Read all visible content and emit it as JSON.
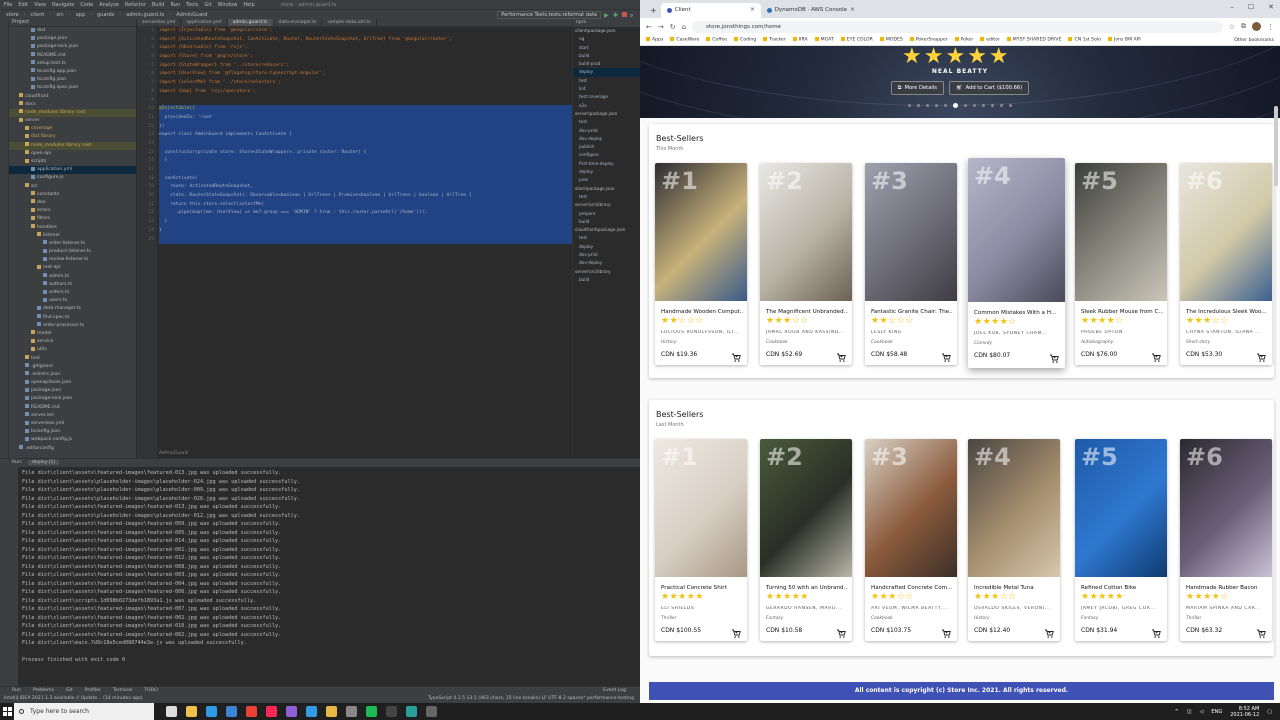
{
  "ide": {
    "menu": [
      "File",
      "Edit",
      "View",
      "Navigate",
      "Code",
      "Analyze",
      "Refactor",
      "Build",
      "Run",
      "Tools",
      "Git",
      "Window",
      "Help"
    ],
    "title": "store - admin.guard.ts",
    "breadcrumbs": [
      "store",
      "client",
      "src",
      "app",
      "guards",
      "admin.guard.ts",
      "AdminGuard"
    ],
    "run_config": "Performance Tests,tests:reformat data",
    "project_label": "Project",
    "tree": [
      {
        "label": "dist",
        "indent": 3
      },
      {
        "label": "package.json",
        "indent": 3
      },
      {
        "label": "package-lock.json",
        "indent": 3
      },
      {
        "label": "README.md",
        "indent": 3
      },
      {
        "label": "setup.test.ts",
        "indent": 3
      },
      {
        "label": "tsconfig.app.json",
        "indent": 3
      },
      {
        "label": "tsconfig.json",
        "indent": 3
      },
      {
        "label": "tsconfig.spec.json",
        "indent": 3
      },
      {
        "label": "cloudfront",
        "indent": 1
      },
      {
        "label": "docs",
        "indent": 1
      },
      {
        "label": "node_modules library root",
        "indent": 1
      },
      {
        "label": "server",
        "indent": 1
      },
      {
        "label": "coverage",
        "indent": 2
      },
      {
        "label": "dist library",
        "indent": 2
      },
      {
        "label": "node_modules library root",
        "indent": 2
      },
      {
        "label": "open-api",
        "indent": 2
      },
      {
        "label": "scripts",
        "indent": 2
      },
      {
        "label": "application.yml",
        "indent": 3
      },
      {
        "label": "configure.js",
        "indent": 3
      },
      {
        "label": "src",
        "indent": 2
      },
      {
        "label": "constants",
        "indent": 3
      },
      {
        "label": "dao",
        "indent": 3
      },
      {
        "label": "errors",
        "indent": 3
      },
      {
        "label": "filters",
        "indent": 3
      },
      {
        "label": "handlers",
        "indent": 3
      },
      {
        "label": "listener",
        "indent": 4
      },
      {
        "label": "order-listener.ts",
        "indent": 5
      },
      {
        "label": "product-listener.ts",
        "indent": 5
      },
      {
        "label": "review-listener.ts",
        "indent": 5
      },
      {
        "label": "rest-api",
        "indent": 4
      },
      {
        "label": "admin.ts",
        "indent": 5
      },
      {
        "label": "authors.ts",
        "indent": 5
      },
      {
        "label": "orders.ts",
        "indent": 5
      },
      {
        "label": "users.ts",
        "indent": 5
      },
      {
        "label": "data-manager.ts",
        "indent": 4
      },
      {
        "label": "find.spec.ts",
        "indent": 4
      },
      {
        "label": "order-processor.ts",
        "indent": 4
      },
      {
        "label": "model",
        "indent": 3
      },
      {
        "label": "service",
        "indent": 3
      },
      {
        "label": "utils",
        "indent": 3
      },
      {
        "label": "test",
        "indent": 2
      },
      {
        "label": ".gitignore",
        "indent": 2
      },
      {
        "label": ".eslintrc.json",
        "indent": 2
      },
      {
        "label": "openapitools.json",
        "indent": 2
      },
      {
        "label": "package.json",
        "indent": 2
      },
      {
        "label": "package-lock.json",
        "indent": 2
      },
      {
        "label": "README.md",
        "indent": 2
      },
      {
        "label": "server.iml",
        "indent": 2
      },
      {
        "label": "serverless.yml",
        "indent": 2
      },
      {
        "label": "tsconfig.json",
        "indent": 2
      },
      {
        "label": "webpack.config.js",
        "indent": 2
      },
      {
        "label": ".editorconfig",
        "indent": 1
      }
    ],
    "tabs": [
      "serverless.yml",
      "application.yml",
      "admin.guard.ts",
      "data-manager.ts",
      "sample-data.util.ts"
    ],
    "active_tab": 2,
    "code": [
      "import {Injectable} from '@angular/core';",
      "import {ActivatedRouteSnapshot, CanActivate, Router, RouterStateSnapshot, UrlTree} from '@angular/router';",
      "import {Observable} from 'rxjs';",
      "import {Store} from '@ngrx/store';",
      "import {StateWrapper} from '../store/reducers';",
      "import {UserView} from '@flagship/store-typescript-angular';",
      "import {selectMe} from '../store/selectors';",
      "import {map} from 'rxjs/operators';",
      "",
      "@Injectable({",
      "  providedIn: 'root'",
      "})",
      "export class AdminGuard implements CanActivate {",
      "",
      "  constructor(private store: Store<StateWrapper>, private router: Router) {",
      "  }",
      "",
      "  canActivate(",
      "    route: ActivatedRouteSnapshot,",
      "    state: RouterStateSnapshot): Observable<boolean | UrlTree> | Promise<boolean | UrlTree> | boolean | UrlTree {",
      "    return this.store.select(selectMe)",
      "      .pipe(map((me: UserView) => me?.group === 'ADMIN' ? true : this.router.parseUrl('/home')));",
      "  }",
      "}",
      ""
    ],
    "editor_footer": "AdminGuard",
    "npm_panel_label": "npm",
    "npm_scripts": [
      "client\\package.json",
      "ng",
      "start",
      "build",
      "build-prod",
      "deploy",
      "test",
      "lint",
      "test:coverage",
      "e2e",
      "server\\package.json",
      "test",
      "dev-print",
      "dev-deploy",
      "publish",
      "configure",
      "first-time-deploy",
      "deploy",
      "prex",
      "store\\package.json",
      "test",
      "server\\src\\library",
      "prepare",
      "build",
      "cloudfront\\package.json",
      "test",
      "deploy",
      "dev-print",
      "dev-deploy",
      "server\\src\\library",
      "build"
    ],
    "run_tab_label": "Run:",
    "run_config_name": "deploy [1]",
    "console_lines": [
      "File dist\\client\\assets\\featured-images\\featured-013.jpg was uploaded successfully.",
      "File dist\\client\\assets\\placeholder-images\\placeholder-024.jpg was uploaded successfully.",
      "File dist\\client\\assets\\placeholder-images\\placeholder-009.jpg was uploaded successfully.",
      "File dist\\client\\assets\\placeholder-images\\placeholder-026.jpg was uploaded successfully.",
      "File dist\\client\\assets\\featured-images\\featured-013.jpg was uploaded successfully.",
      "File dist\\client\\assets\\placeholder-images\\placeholder-012.jpg was uploaded successfully.",
      "File dist\\client\\assets\\featured-images\\featured-009.jpg was uploaded successfully.",
      "File dist\\client\\assets\\featured-images\\featured-005.jpg was uploaded successfully.",
      "File dist\\client\\assets\\featured-images\\featured-014.jpg was uploaded successfully.",
      "File dist\\client\\assets\\featured-images\\featured-001.jpg was uploaded successfully.",
      "File dist\\client\\assets\\featured-images\\featured-012.jpg was uploaded successfully.",
      "File dist\\client\\assets\\featured-images\\featured-008.jpg was uploaded successfully.",
      "File dist\\client\\assets\\featured-images\\featured-003.jpg was uploaded successfully.",
      "File dist\\client\\assets\\featured-images\\featured-004.jpg was uploaded successfully.",
      "File dist\\client\\assets\\featured-images\\featured-006.jpg was uploaded successfully.",
      "File dist\\client\\scripts.1d098b0273defb1893a1.js was uploaded successfully.",
      "File dist\\client\\assets\\featured-images\\featured-007.jpg was uploaded successfully.",
      "File dist\\client\\assets\\featured-images\\featured-002.jpg was uploaded successfully.",
      "File dist\\client\\assets\\featured-images\\featured-010.jpg was uploaded successfully.",
      "File dist\\client\\assets\\featured-images\\featured-002.jpg was uploaded successfully.",
      "File dist\\client\\main.7d9c18e5ced080744e3e.js was uploaded successfully.",
      "",
      "Process finished with exit code 0"
    ],
    "bottom_tabs": [
      "Run",
      "Problems",
      "Git",
      "Profiler",
      "Terminal",
      "TODO"
    ],
    "event_log": "Event Log",
    "status_left": "IntelliJ IDEA 2021.1.3 available // Update... (14 minutes ago)",
    "status_right": "TypeScript 4.1.5   13:1 (463 chars, 15 line breaks)   LF   UTF-8   2 spaces*   performance-testing"
  },
  "browser": {
    "tabs": [
      {
        "label": "Client",
        "active": true
      },
      {
        "label": "DynamoDB · AWS Console",
        "active": false
      }
    ],
    "url": "store.jonsthings.com/home",
    "bookmarks": [
      "Apps",
      "CaseWare",
      "Coffee",
      "Coding",
      "Tracker",
      "IIRA",
      "MGAT",
      "EYE COLOR",
      "MODES",
      "PokerSnapper",
      "Poker",
      "editor",
      "MYST SHARED DRIVE",
      "CN 1st Solo",
      "Jons BM API"
    ],
    "other_bookmarks": "Other bookmarks",
    "hero": {
      "author": "NEAL BEATTY",
      "rating": 5,
      "more_details": "More Details",
      "add_to_cart": "Add to Cart ($100.66)",
      "dots": 12,
      "active_dot": 5
    },
    "sections": [
      {
        "title": "Best-Sellers",
        "subtitle": "This Month",
        "books": [
          {
            "rank": "#1",
            "title": "Handmade Wooden Comput...",
            "rating": 2,
            "authors": "LUCIOUS RUNOLFSSON, ILI...",
            "genre": "History",
            "price": "CDN $19.36",
            "colors": [
              "#2d2d33",
              "#c8b27a",
              "#3a5a8a"
            ]
          },
          {
            "rank": "#2",
            "title": "The Magnificent Unbranded...",
            "rating": 3,
            "authors": "JAMAL ROOB AND KASSIND...",
            "genre": "Cookbook",
            "price": "CDN $52.69",
            "colors": [
              "#e8e8e4",
              "#b9b3a6",
              "#6b6154"
            ]
          },
          {
            "rank": "#3",
            "title": "Fantastic Granite Chair: The...",
            "rating": 2,
            "authors": "LESLY KING",
            "genre": "Cookbook",
            "price": "CDN $58.48",
            "colors": [
              "#9ea1ae",
              "#6c6b77",
              "#3f3c42"
            ]
          },
          {
            "rank": "#4",
            "title": "Common Mistakes With a H...",
            "rating": 4,
            "authors": "JOEL KUB, SYDNEY CHAM...",
            "genre": "Comedy",
            "price": "CDN $80.07",
            "colors": [
              "#b6b5c9",
              "#8c8aa3",
              "#4b4a58"
            ]
          },
          {
            "rank": "#5",
            "title": "Sleek Rubber Mouse from C...",
            "rating": 4,
            "authors": "PHOEBE UPTON",
            "genre": "Autobiography",
            "price": "CDN $76.00",
            "colors": [
              "#3c3f3a",
              "#8e8c82",
              "#c9c5b8"
            ]
          },
          {
            "rank": "#6",
            "title": "The Incredulous Sleek Woo...",
            "rating": 3,
            "authors": "CHYNA STANTON, ILIANA ...",
            "genre": "Short story",
            "price": "CDN $53.30",
            "colors": [
              "#e8e6df",
              "#d2c9a8",
              "#3b5f8f"
            ]
          }
        ]
      },
      {
        "title": "Best-Sellers",
        "subtitle": "Last Month",
        "books": [
          {
            "rank": "#1",
            "title": "Practical Concrete Shirt",
            "rating": 5,
            "authors": "ELI SHIELDS",
            "genre": "Thriller",
            "price": "CDN $100.55",
            "colors": [
              "#efe9e2",
              "#d8cfc4",
              "#a89886"
            ]
          },
          {
            "rank": "#2",
            "title": "Turning 50 with an Unbrand...",
            "rating": 5,
            "authors": "GERARDO HANSEN, MARG...",
            "genre": "Fantasy",
            "price": "CDN $10.58",
            "colors": [
              "#4a5b3c",
              "#2a2f25",
              "#b9b7a8"
            ]
          },
          {
            "rank": "#3",
            "title": "Handcrafted Concrete Com...",
            "rating": 3,
            "authors": "ARI VEUM, WILMA BEATTY,...",
            "genre": "Cookbook",
            "price": "CDN $103.75",
            "colors": [
              "#d9d2c6",
              "#8a5a3c",
              "#3c2f28"
            ]
          },
          {
            "rank": "#4",
            "title": "Incredible Metal Tuna",
            "rating": 3,
            "authors": "OSVALDO SKILES, VERONI...",
            "genre": "History",
            "price": "CDN $12.40",
            "colors": [
              "#4a4642",
              "#a58e6e",
              "#d8c7ab"
            ]
          },
          {
            "rank": "#5",
            "title": "Refined Cotton Bike",
            "rating": 5,
            "authors": "JAMEY JACOBI, GREG COR...",
            "genre": "Fantasy",
            "price": "CDN $31.94",
            "colors": [
              "#1e5aa8",
              "#2f78d0",
              "#0f3a70"
            ]
          },
          {
            "rank": "#6",
            "title": "Handmade Rubber Bacon",
            "rating": 4,
            "authors": "MARIAM SPINKA AND CAR...",
            "genre": "Thriller",
            "price": "CDN $63.32",
            "colors": [
              "#2a2a30",
              "#6b5f78",
              "#c9c2d6"
            ]
          }
        ]
      }
    ],
    "footer": "All content is copyright (c) Store Inc. 2021. All rights reserved."
  },
  "taskbar": {
    "search_placeholder": "Type here to search",
    "time": "8:52 AM",
    "date": "2021-06-12",
    "lang": "ENG"
  }
}
